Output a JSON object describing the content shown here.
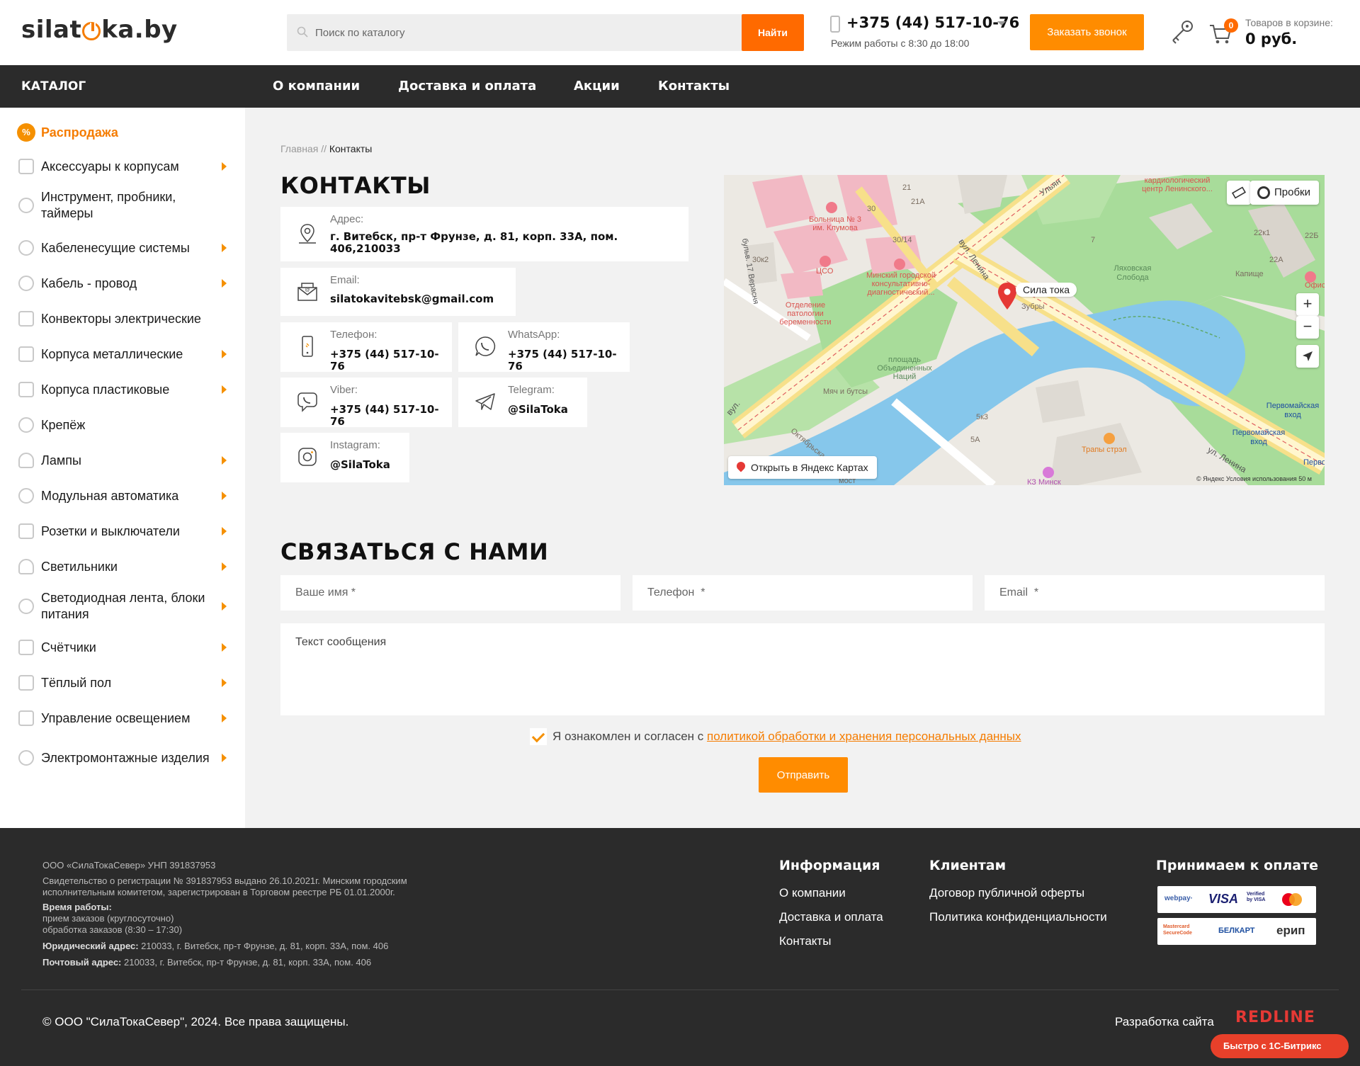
{
  "header": {
    "logo_text_left": "silat",
    "logo_text_right": "ka.by",
    "search_placeholder": "Поиск по каталогу",
    "search_button": "Найти",
    "phone": "+375 (44) 517-10-76",
    "work_hours": "Режим работы с 8:30 до 18:00",
    "callback_button": "Заказать звонок",
    "cart_count": "0",
    "cart_label": "Товаров в корзине:",
    "cart_total": "0 руб."
  },
  "nav": {
    "catalog": "КАТАЛОГ",
    "links": [
      "О компании",
      "Доставка и оплата",
      "Акции",
      "Контакты"
    ]
  },
  "sidebar": {
    "sale": "Распродажа",
    "items": [
      {
        "label": "Аксессуары к корпусам",
        "has_arrow": true
      },
      {
        "label": "Инструмент, пробники, таймеры",
        "has_arrow": false
      },
      {
        "label": "Кабеленесущие системы",
        "has_arrow": true
      },
      {
        "label": "Кабель - провод",
        "has_arrow": true
      },
      {
        "label": "Конвекторы электрические",
        "has_arrow": false
      },
      {
        "label": "Корпуса металлические",
        "has_arrow": true
      },
      {
        "label": "Корпуса пластиковые",
        "has_arrow": true
      },
      {
        "label": "Крепёж",
        "has_arrow": false
      },
      {
        "label": "Лампы",
        "has_arrow": true
      },
      {
        "label": "Модульная автоматика",
        "has_arrow": true
      },
      {
        "label": "Розетки и выключатели",
        "has_arrow": true
      },
      {
        "label": "Светильники",
        "has_arrow": true
      },
      {
        "label": "Светодиодная лента, блоки питания",
        "has_arrow": true
      },
      {
        "label": "Счётчики",
        "has_arrow": true
      },
      {
        "label": "Тёплый пол",
        "has_arrow": true
      },
      {
        "label": "Управление освещением",
        "has_arrow": true
      },
      {
        "label": "Электромонтажные изделия",
        "has_arrow": true
      }
    ]
  },
  "breadcrumb": {
    "home": "Главная",
    "separator": "//",
    "current": "Контакты"
  },
  "page_title": "КОНТАКТЫ",
  "contacts": {
    "address": {
      "label": "Адрес:",
      "value": "г. Витебск, пр-т Фрунзе, д. 81, корп. 33А, пом. 406,210033",
      "icon": "location-pin-icon"
    },
    "email": {
      "label": "Email:",
      "value": "silatokavitebsk@gmail.com",
      "icon": "envelope-icon"
    },
    "phone": {
      "label": "Телефон:",
      "value": "+375 (44) 517-10-76",
      "icon": "mobile-phone-icon"
    },
    "whatsapp": {
      "label": "WhatsApp:",
      "value": "+375 (44) 517-10-76",
      "icon": "whatsapp-icon"
    },
    "viber": {
      "label": "Viber:",
      "value": "+375 (44) 517-10-76",
      "icon": "viber-icon"
    },
    "telegram": {
      "label": "Telegram:",
      "value": "@SilaToka",
      "icon": "telegram-icon"
    },
    "instagram": {
      "label": "Instagram:",
      "value": "@SilaToka",
      "icon": "instagram-icon"
    }
  },
  "map": {
    "place_label": "Сила тока",
    "traffic_button": "Пробки",
    "open_in_maps": "Открыть в Яндекс Картах",
    "zoom_in": "+",
    "zoom_out": "−",
    "copyright": "© Яндекс   Условия использования   50 м",
    "labels": {
      "hospital": "Больница № 3 им. Клумова",
      "cso": "ЦСО",
      "diagnostic": "Минский городской консультативно-диагностический...",
      "pathology": "Отделение патологии беременности",
      "cardio": "кардиологический центр Ленинского...",
      "street_lenina": "вул. Ленина",
      "zubry": "Зубры",
      "lyakhovskaya": "Ляховская Слобода",
      "kapishche": "Капище",
      "square": "площадь Объединенных Наций",
      "ball": "Мяч и бутсы",
      "pervomaiskaya1": "Первомайская вход",
      "pervomaiskaya2": "Первомайская вход",
      "trapy": "Трапы стрэл",
      "street_lenina2": "ул. Ленина",
      "street_oktyabrskaya": "Октябрьская",
      "street_boulevard": "бульв. 17 Верасня",
      "office": "Офис",
      "n21": "21",
      "n21a": "21A",
      "n30": "30",
      "n30_14": "30/14",
      "n30k2": "30к2",
      "n7": "7",
      "n22k1": "22к1",
      "n22a": "22A",
      "n22b": "22Б",
      "n5k3": "5к3",
      "n5a": "5А",
      "street_ul": "Ульян",
      "street_vul": "вул.",
      "most": "мост",
      "kz": "КЗ Минск",
      "pervo3": "Перво"
    }
  },
  "form": {
    "title": "СВЯЗАТЬСЯ С НАМИ",
    "name_placeholder": "Ваше имя *",
    "phone_placeholder": "Телефон  *",
    "email_placeholder": "Email  *",
    "message_placeholder": "Текст сообщения",
    "consent_text": "Я ознакомлен и согласен с ",
    "consent_link": "политикой обработки и хранения персональных данных",
    "submit": "Отправить"
  },
  "footer": {
    "company": "ООО «СилаТокаСевер» УНП 391837953",
    "registration": "Свидетельство о регистрации № 391837953 выдано 26.10.2021г. Минским городским исполнительным комитетом, зарегистрирован в Торговом реестре РБ 01.01.2000г.",
    "hours_label": "Время работы:",
    "hours_line1": "прием заказов (круглосуточно)",
    "hours_line2": "обработка заказов (8:30 – 17:30)",
    "legal_label": "Юридический адрес:",
    "legal_value": " 210033, г. Витебск, пр-т Фрунзе, д. 81, корп. 33А, пом. 406",
    "postal_label": "Почтовый адрес:",
    "postal_value": " 210033, г. Витебск, пр-т Фрунзе, д. 81, корп. 33А, пом. 406",
    "info_title": "Информация",
    "info_links": [
      "О компании",
      "Доставка и оплата",
      "Контакты"
    ],
    "clients_title": "Клиентам",
    "clients_links": [
      "Договор публичной оферты",
      "Политика конфиденциальности"
    ],
    "payment_title": "Принимаем к оплате",
    "payment_row1": [
      "webpay·",
      "VISA",
      "Verified by VISA",
      "mastercard"
    ],
    "payment_row2": [
      "Mastercard SecureCode",
      "БЕЛКАРТ",
      "ерип"
    ],
    "copyright": "© ООО \"СилаТокаСевер\", 2024. Все права защищены.",
    "dev_credit": "Разработка сайта",
    "dev_logo": "REDLINE",
    "bitrix_badge": "Быстро с 1С-Битрикс"
  },
  "colors": {
    "accent_orange": "#ff8c00",
    "search_button": "#ff6a00",
    "dark_bar": "#2b2b2b",
    "link_orange": "#f57c00"
  }
}
